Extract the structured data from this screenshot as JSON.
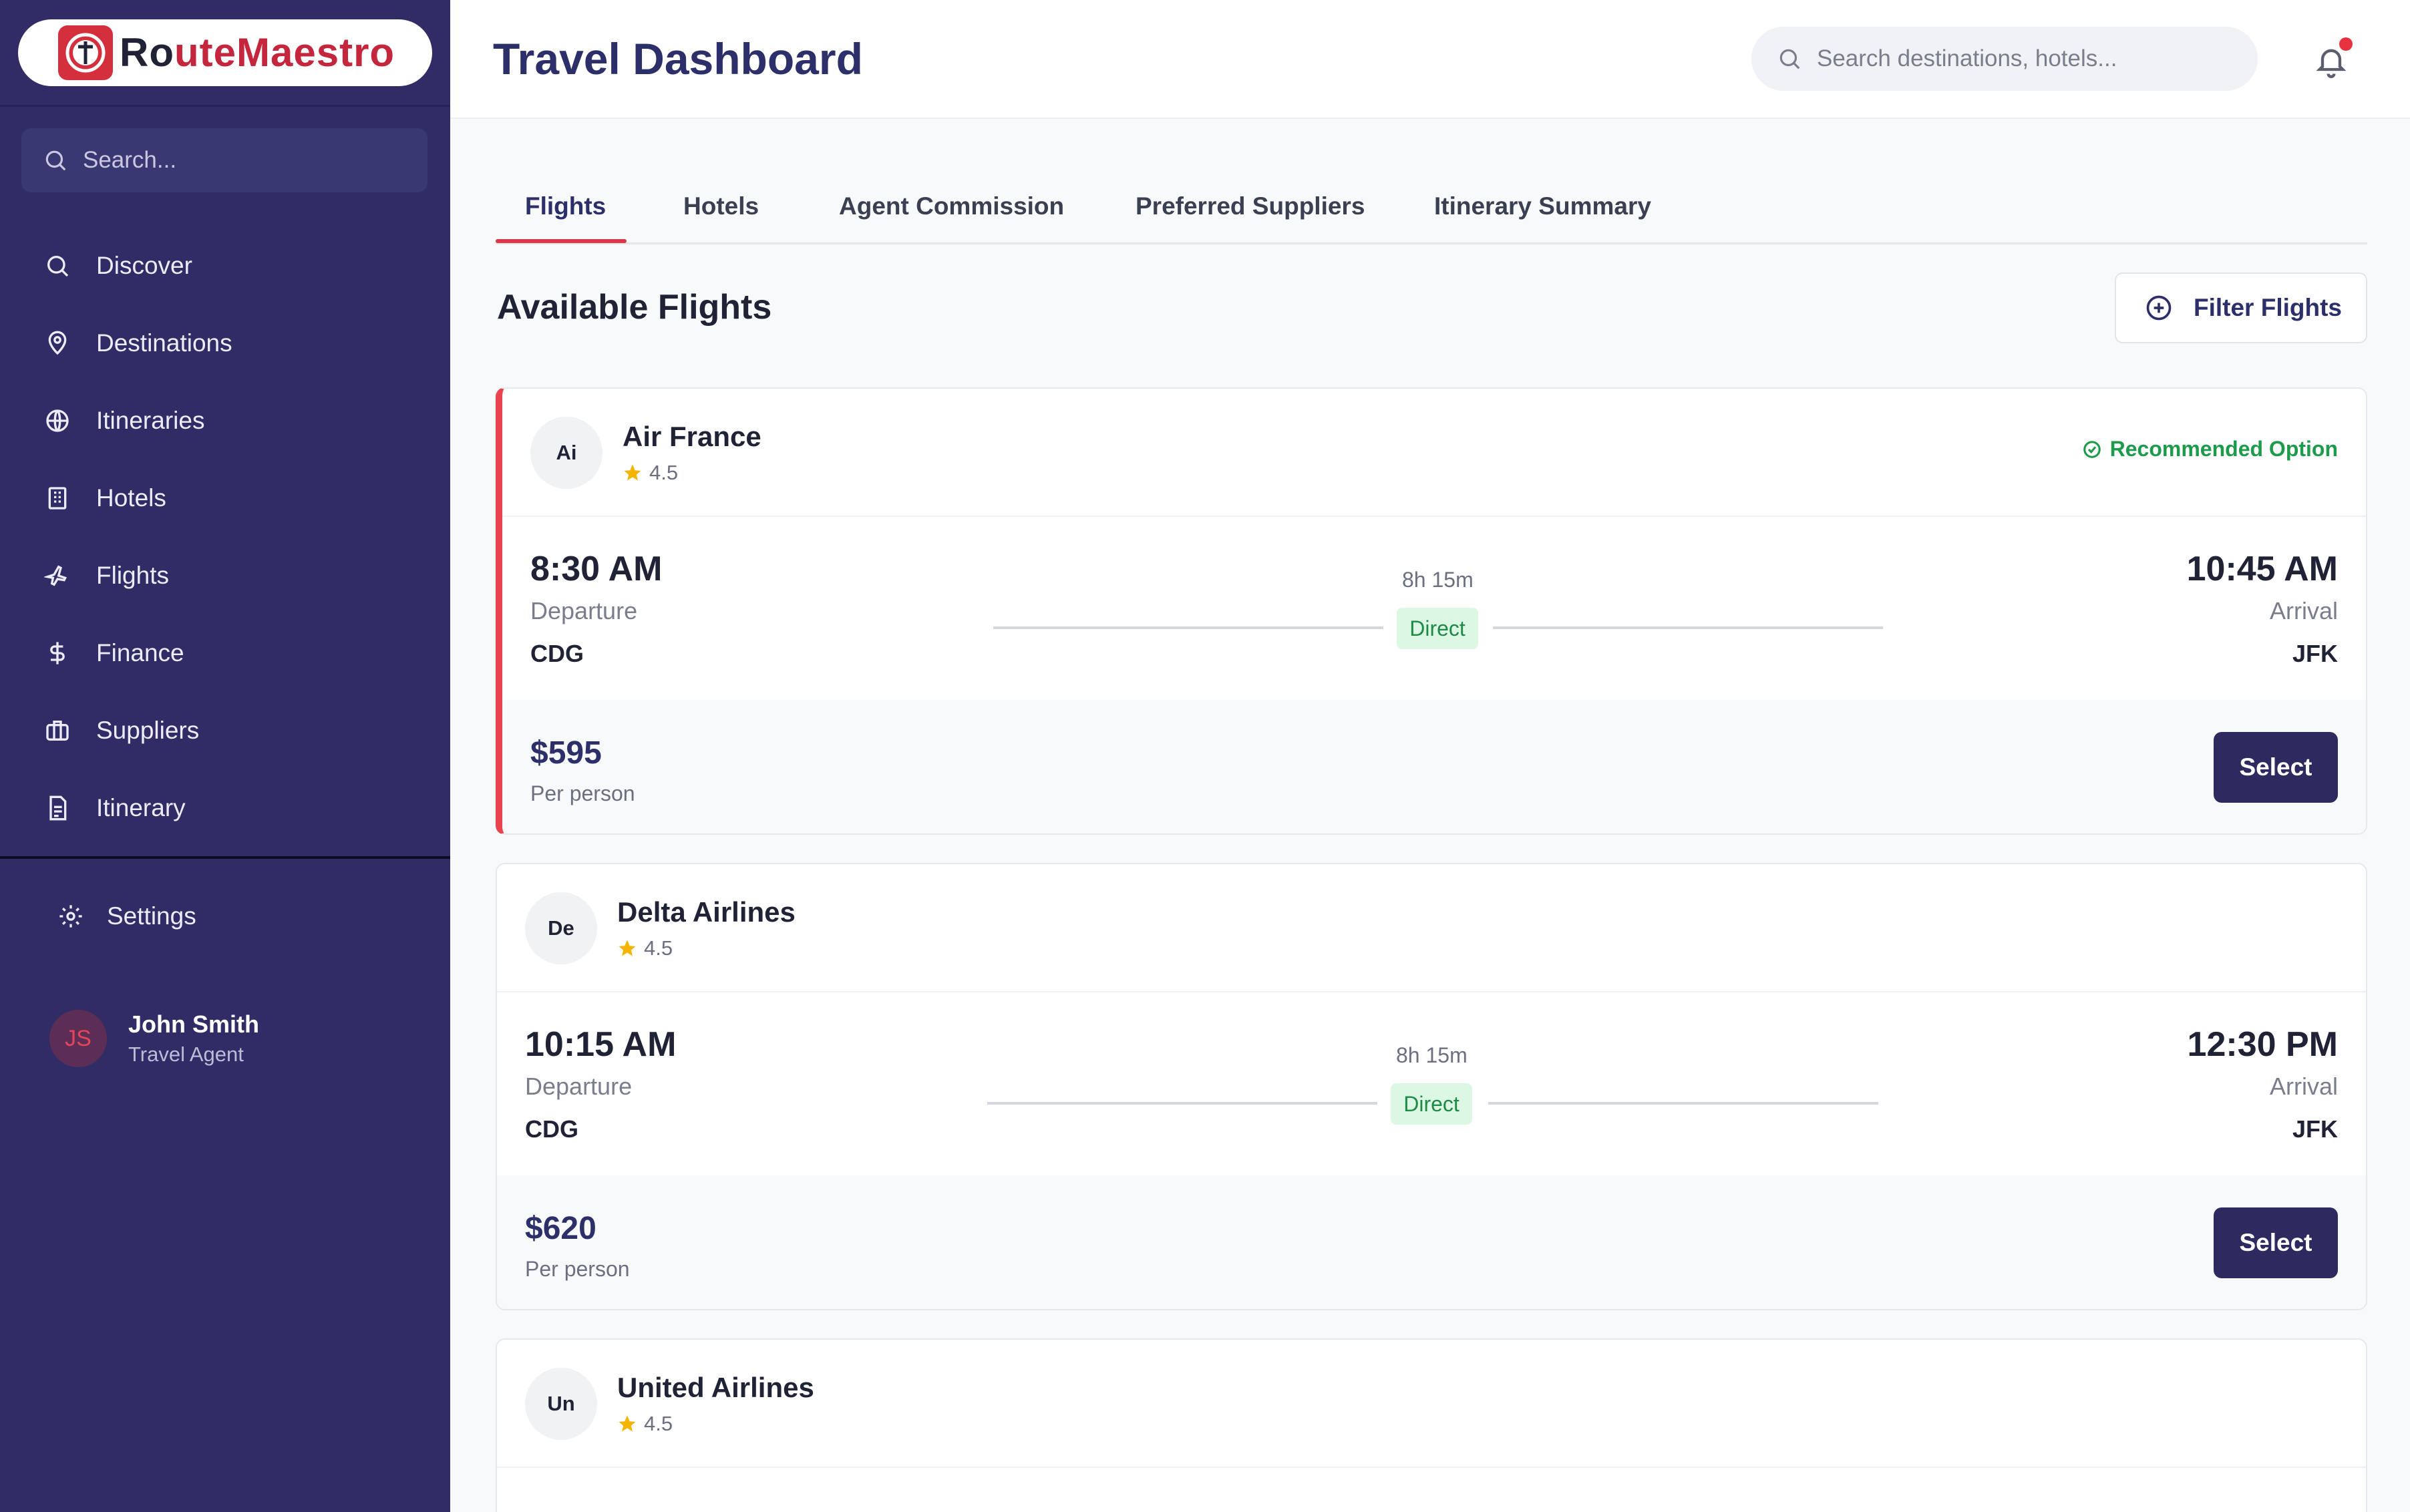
{
  "app": {
    "brand_prefix": "R",
    "brand_rest": "uteMaestro",
    "brand_mark_glyph": "o",
    "accent": "#d42f3c",
    "sidebar_bg": "#302d66"
  },
  "sidebar": {
    "search_placeholder": "Search...",
    "items": [
      {
        "label": "Discover",
        "icon": "search-icon"
      },
      {
        "label": "Destinations",
        "icon": "map-pin-icon"
      },
      {
        "label": "Itineraries",
        "icon": "globe-icon"
      },
      {
        "label": "Hotels",
        "icon": "building-icon"
      },
      {
        "label": "Flights",
        "icon": "plane-icon"
      },
      {
        "label": "Finance",
        "icon": "dollar-icon"
      },
      {
        "label": "Suppliers",
        "icon": "briefcase-icon"
      },
      {
        "label": "Itinerary",
        "icon": "document-icon"
      }
    ],
    "settings_label": "Settings",
    "user": {
      "initials": "JS",
      "name": "John Smith",
      "role": "Travel Agent"
    }
  },
  "header": {
    "title": "Travel Dashboard",
    "search_placeholder": "Search destinations, hotels...",
    "has_notification": true
  },
  "tabs": [
    {
      "label": "Flights",
      "active": true
    },
    {
      "label": "Hotels",
      "active": false
    },
    {
      "label": "Agent Commission",
      "active": false
    },
    {
      "label": "Preferred Suppliers",
      "active": false
    },
    {
      "label": "Itinerary Summary",
      "active": false
    }
  ],
  "main": {
    "section_title": "Available Flights",
    "filter_label": "Filter Flights"
  },
  "flights": [
    {
      "initials": "Ai",
      "airline": "Air France",
      "rating": "4.5",
      "recommended": true,
      "recommended_label": "Recommended Option",
      "departure_time": "8:30 AM",
      "departure_label": "Departure",
      "from": "CDG",
      "duration": "8h 15m",
      "stops": "Direct",
      "arrival_time": "10:45 AM",
      "arrival_label": "Arrival",
      "to": "JFK",
      "price": "$595",
      "price_unit": "Per person",
      "select_label": "Select"
    },
    {
      "initials": "De",
      "airline": "Delta Airlines",
      "rating": "4.5",
      "recommended": false,
      "recommended_label": "",
      "departure_time": "10:15 AM",
      "departure_label": "Departure",
      "from": "CDG",
      "duration": "8h 15m",
      "stops": "Direct",
      "arrival_time": "12:30 PM",
      "arrival_label": "Arrival",
      "to": "JFK",
      "price": "$620",
      "price_unit": "Per person",
      "select_label": "Select"
    },
    {
      "initials": "Un",
      "airline": "United Airlines",
      "rating": "4.5",
      "recommended": false,
      "recommended_label": "",
      "departure_time": "",
      "departure_label": "",
      "from": "",
      "duration": "",
      "stops": "",
      "arrival_time": "",
      "arrival_label": "",
      "to": "",
      "price": "",
      "price_unit": "",
      "select_label": ""
    }
  ]
}
